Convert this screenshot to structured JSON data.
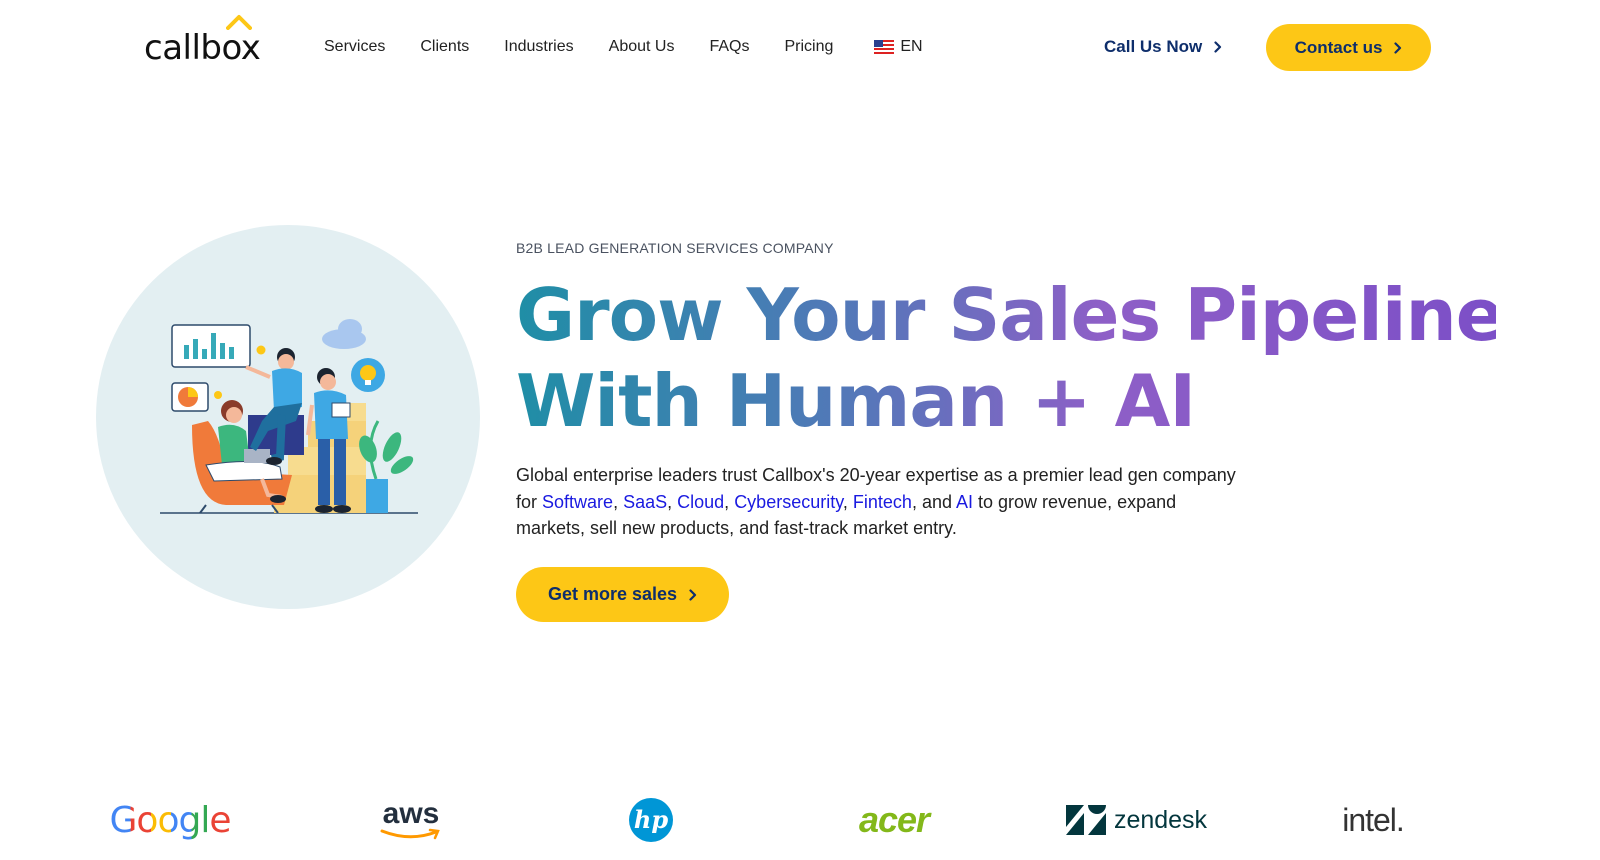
{
  "header": {
    "logo_text": "callbox",
    "nav": [
      {
        "label": "Services"
      },
      {
        "label": "Clients"
      },
      {
        "label": "Industries"
      },
      {
        "label": "About Us"
      },
      {
        "label": "FAQs"
      },
      {
        "label": "Pricing"
      }
    ],
    "language": "EN",
    "call_label": "Call Us Now",
    "contact_label": "Contact us"
  },
  "hero": {
    "kicker": "B2B LEAD GENERATION SERVICES COMPANY",
    "headline_line1": "Grow Your Sales Pipeline",
    "headline_line2": "With Human + AI",
    "desc_part1": "Global enterprise leaders trust Callbox's 20-year expertise as a premier lead gen company for ",
    "links": [
      "Software",
      "SaaS",
      "Cloud",
      "Cybersecurity",
      "Fintech",
      "AI"
    ],
    "sep1": ", ",
    "sep_and": ", and ",
    "desc_part2": " to grow revenue, expand markets, sell new products, and fast-track market entry.",
    "cta_label": "Get more sales"
  },
  "clients": {
    "google": "Google",
    "aws": "aws",
    "acer": "acer",
    "zendesk": "zendesk",
    "intel": "intel."
  },
  "colors": {
    "accent_yellow": "#fdc716",
    "navy": "#0e2e6b",
    "link_blue": "#1a1ae0",
    "gradient_start": "#1f8ea6",
    "gradient_end": "#7c4fc7"
  },
  "icons": [
    "chevron-right-icon",
    "us-flag-icon",
    "caret-up-icon"
  ]
}
